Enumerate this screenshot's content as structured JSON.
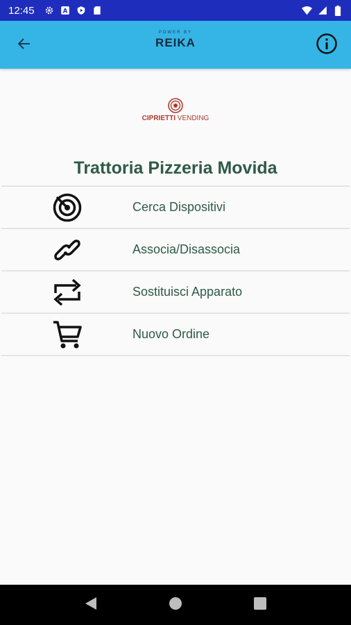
{
  "status_bar": {
    "time": "12:45",
    "icons": [
      "gear-icon",
      "a-badge-icon",
      "play-shield-icon",
      "sd-card-icon"
    ],
    "right_icons": [
      "wifi-icon",
      "cell-signal-icon",
      "battery-icon"
    ]
  },
  "app_bar": {
    "back_icon": "arrow-back-icon",
    "logo_top": "POWER BY",
    "logo_brand": "REIKA",
    "info_icon": "info-icon",
    "background_color": "#35b5e6"
  },
  "company": {
    "name_bold": "CIPRIETTI",
    "name_rest": " VENDING"
  },
  "title": "Trattoria Pizzeria Movida",
  "menu": [
    {
      "label": "Cerca Dispositivi",
      "icon": "radar-icon"
    },
    {
      "label": "Associa/Disassocia",
      "icon": "link-icon"
    },
    {
      "label": "Sostituisci Apparato",
      "icon": "swap-arrows-icon"
    },
    {
      "label": "Nuovo Ordine",
      "icon": "cart-icon"
    }
  ],
  "nav_bar": {
    "buttons": [
      "back-triangle-icon",
      "home-circle-icon",
      "recents-square-icon"
    ]
  },
  "colors": {
    "status_bar": "#1f2dbd",
    "text_primary": "#2f5a48",
    "brand_red": "#b03a2e"
  }
}
